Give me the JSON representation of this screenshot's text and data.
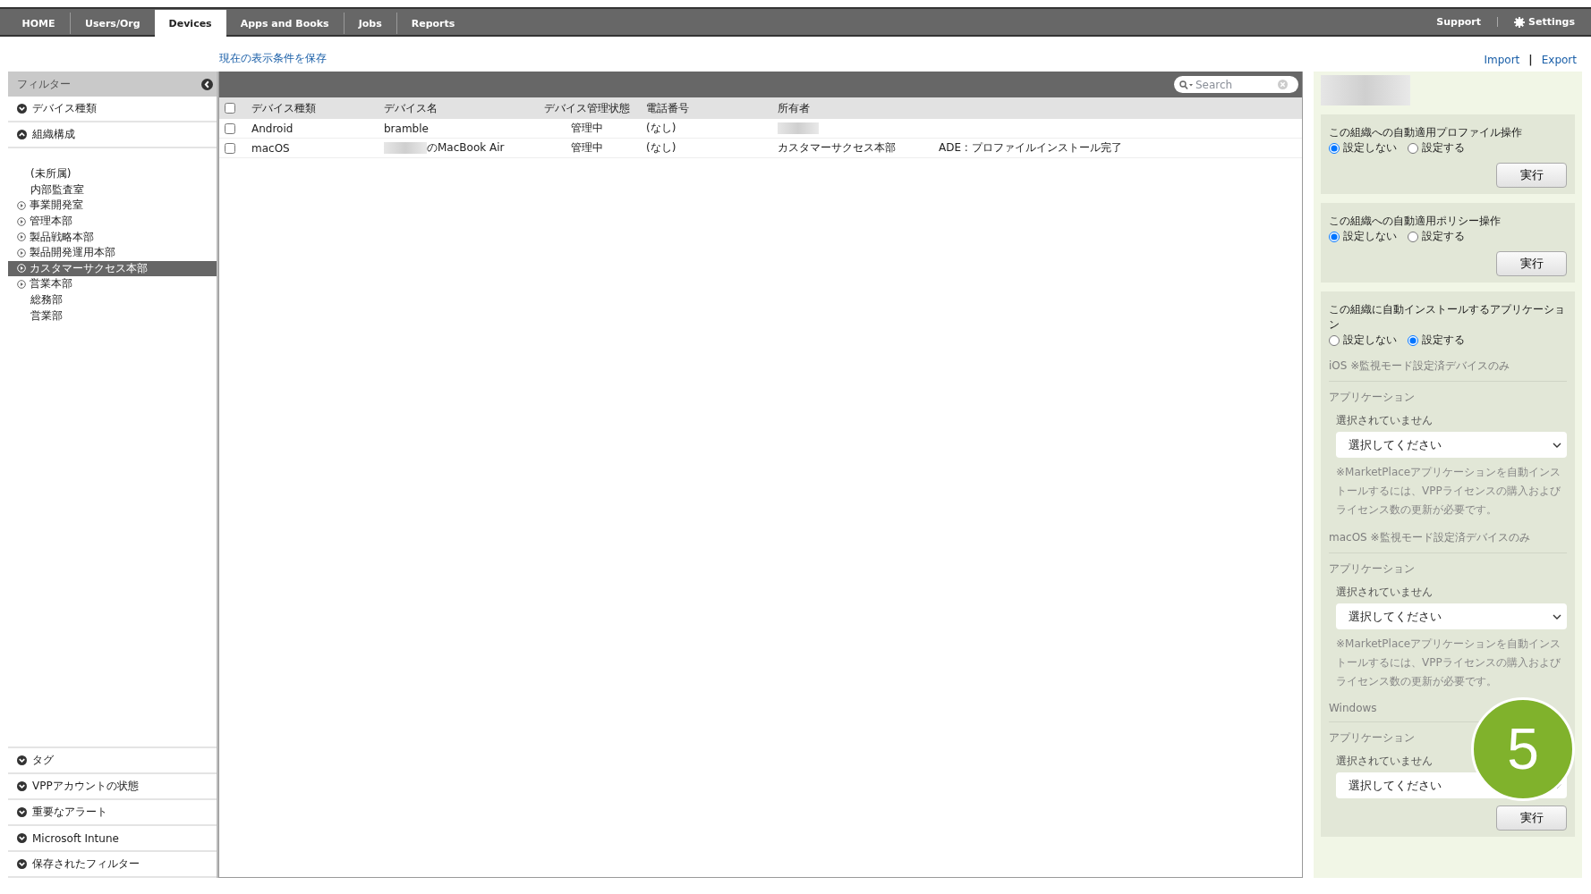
{
  "nav": {
    "tabs": [
      {
        "label": "HOME",
        "selected": false
      },
      {
        "label": "Users/Org",
        "selected": false
      },
      {
        "label": "Devices",
        "selected": true
      },
      {
        "label": "Apps and Books",
        "selected": false
      },
      {
        "label": "Jobs",
        "selected": false
      },
      {
        "label": "Reports",
        "selected": false
      }
    ],
    "right": [
      {
        "label": "Support",
        "kind": "link"
      },
      {
        "label": "Settings",
        "kind": "settings"
      }
    ]
  },
  "save_link": "現在の表示条件を保存",
  "io_links": [
    "Import",
    "Export"
  ],
  "io_separator": "|",
  "filter": {
    "title": "フィルター",
    "top_sections": [
      {
        "label": "デバイス種類",
        "expanded": false
      },
      {
        "label": "組織構成",
        "expanded": true
      }
    ],
    "org_tree": [
      {
        "label": "(未所属)",
        "expandable": false,
        "selected": false
      },
      {
        "label": "内部監査室",
        "expandable": false,
        "selected": false
      },
      {
        "label": "事業開発室",
        "expandable": true,
        "selected": false
      },
      {
        "label": "管理本部",
        "expandable": true,
        "selected": false
      },
      {
        "label": "製品戦略本部",
        "expandable": true,
        "selected": false
      },
      {
        "label": "製品開発運用本部",
        "expandable": true,
        "selected": false
      },
      {
        "label": "カスタマーサクセス本部",
        "expandable": true,
        "selected": true
      },
      {
        "label": "営業本部",
        "expandable": true,
        "selected": false
      },
      {
        "label": "総務部",
        "expandable": false,
        "selected": false
      },
      {
        "label": "営業部",
        "expandable": false,
        "selected": false
      }
    ],
    "bottom_sections": [
      {
        "label": "タグ",
        "expanded": false
      },
      {
        "label": "VPPアカウントの状態",
        "expanded": false
      },
      {
        "label": "重要なアラート",
        "expanded": false
      },
      {
        "label": "Microsoft Intune",
        "expanded": false
      },
      {
        "label": "保存されたフィルター",
        "expanded": false
      }
    ]
  },
  "table": {
    "search": {
      "placeholder": "Search"
    },
    "all_checked": false,
    "columns": [
      "デバイス種類",
      "デバイス名",
      "デバイス管理状態",
      "電話番号",
      "所有者"
    ],
    "rows": [
      {
        "checked": false,
        "cells": [
          "Android",
          "bramble",
          "管理中",
          "(なし)",
          ""
        ],
        "name_redacted": false,
        "owner_redacted": true,
        "status": ""
      },
      {
        "checked": false,
        "cells": [
          "macOS",
          "のMacBook Air",
          "管理中",
          "(なし)",
          "カスタマーサクセス本部"
        ],
        "name_redacted": true,
        "owner_redacted": false,
        "status": "ADE : プロファイルインストール完了"
      }
    ]
  },
  "panel": {
    "sections": [
      {
        "kind": "radio",
        "title": "この組織への自動適用プロファイル操作",
        "options": [
          {
            "label": "設定しない",
            "selected": true
          },
          {
            "label": "設定する",
            "selected": false
          }
        ],
        "button": "実行"
      },
      {
        "kind": "radio",
        "title": "この組織への自動適用ポリシー操作",
        "options": [
          {
            "label": "設定しない",
            "selected": true
          },
          {
            "label": "設定する",
            "selected": false
          }
        ],
        "button": "実行"
      },
      {
        "kind": "apps",
        "title": "この組織に自動インストールするアプリケーション",
        "options": [
          {
            "label": "設定しない",
            "selected": false
          },
          {
            "label": "設定する",
            "selected": true
          }
        ],
        "button": "実行",
        "platforms": [
          {
            "heading": "iOS ※監視モード設定済デバイスのみ",
            "label": "アプリケーション",
            "status": "選択されていません",
            "value": "選択してください",
            "note": "※MarketPlaceアプリケーションを自動インストールするには、VPPライセンスの購入およびライセンス数の更新が必要です。"
          },
          {
            "heading": "macOS ※監視モード設定済デバイスのみ",
            "label": "アプリケーション",
            "status": "選択されていません",
            "value": "選択してください",
            "note": "※MarketPlaceアプリケーションを自動インストールするには、VPPライセンスの購入およびライセンス数の更新が必要です。"
          },
          {
            "heading": "Windows",
            "label": "アプリケーション",
            "status": "選択されていません",
            "value": "選択してください"
          }
        ]
      }
    ]
  },
  "callout": "5"
}
